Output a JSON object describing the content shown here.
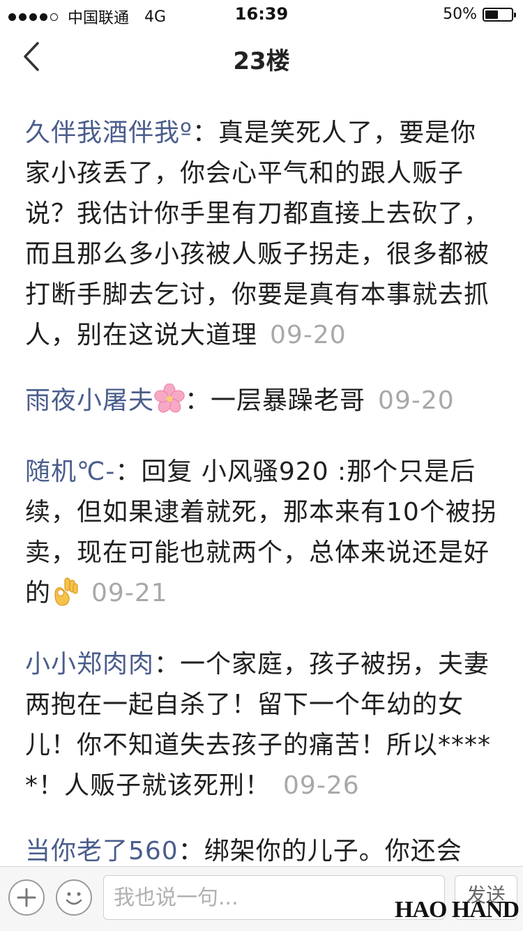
{
  "status_bar": {
    "carrier": "中国联通",
    "network": "4G",
    "time": "16:39",
    "battery_percent": "50%",
    "battery_level": 0.5,
    "signal_bars_filled": 4,
    "signal_bars_total": 5
  },
  "nav": {
    "title": "23楼"
  },
  "comments": [
    {
      "user": "久伴我酒伴我º",
      "sep": "：",
      "text": "真是笑死人了，要是你家小孩丢了，你会心平气和的跟人贩子说？我估计你手里有刀都直接上去砍了，而且那么多小孩被人贩子拐走，很多都被打断手脚去乞讨，你要是真有本事就去抓人，别在这说大道理",
      "date": "09-20"
    },
    {
      "user": "雨夜小屠夫",
      "sep": "：",
      "text": "一层暴躁老哥",
      "date": "09-20",
      "emoji": "cherry-blossom"
    },
    {
      "user": "随机℃-",
      "sep": "：",
      "text": "回复 小风骚920 :那个只是后续，但如果逮着就死，那本来有10个被拐卖，现在可能也就两个，总体来说还是好的",
      "date": "09-21",
      "emoji": "ok-hand"
    },
    {
      "user": "小小郑肉肉",
      "sep": "：",
      "text": "一个家庭，孩子被拐，夫妻两抱在一起自杀了！留下一个年幼的女儿！你不知道失去孩子的痛苦！所以*****！人贩子就该死刑！",
      "date": "09-26"
    },
    {
      "user": "当你老了560",
      "sep": "：",
      "text": "绑架你的儿子。你还会",
      "date": ""
    }
  ],
  "input_bar": {
    "placeholder": "我也说一句...",
    "send_label": "发送"
  },
  "watermark": "HAO HAND",
  "colors": {
    "username": "#4a5d8c",
    "date": "#a8a8a8",
    "text": "#1f1f1f"
  }
}
